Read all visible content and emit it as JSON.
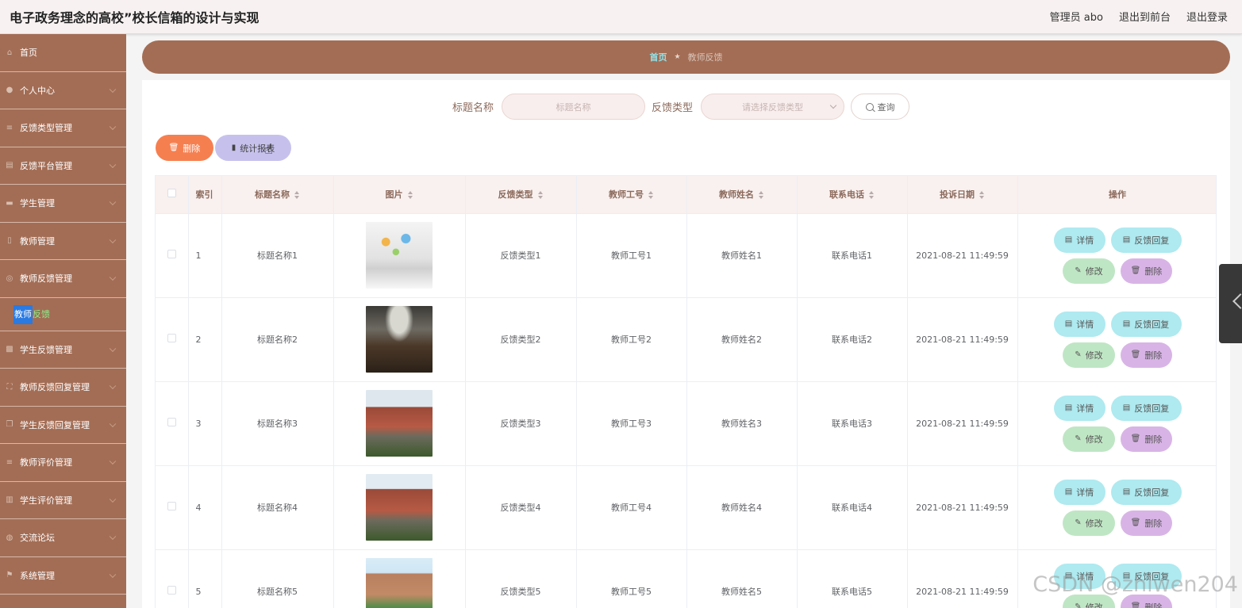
{
  "header": {
    "title": "电子政务理念的高校”校长信箱的设计与实现",
    "admin": "管理员 abo",
    "to_front": "退出到前台",
    "logout": "退出登录"
  },
  "sidebar": {
    "items": [
      {
        "label": "首页",
        "icon": "home-icon",
        "has_arrow": false
      },
      {
        "label": "个人中心",
        "icon": "user-icon",
        "has_arrow": true
      },
      {
        "label": "反馈类型管理",
        "icon": "list-icon",
        "has_arrow": true
      },
      {
        "label": "反馈平台管理",
        "icon": "document-icon",
        "has_arrow": true
      },
      {
        "label": "学生管理",
        "icon": "chat-icon",
        "has_arrow": true
      },
      {
        "label": "教师管理",
        "icon": "phone-icon",
        "has_arrow": true
      },
      {
        "label": "教师反馈管理",
        "icon": "compass-icon",
        "has_arrow": true
      }
    ],
    "active_sub": {
      "highlight": "教师",
      "rest": "反馈"
    },
    "items_after": [
      {
        "label": "学生反馈管理",
        "icon": "grid-icon",
        "has_arrow": true
      },
      {
        "label": "教师反馈回复管理",
        "icon": "frame-icon",
        "has_arrow": true
      },
      {
        "label": "学生反馈回复管理",
        "icon": "copy-icon",
        "has_arrow": true
      },
      {
        "label": "教师评价管理",
        "icon": "list-icon",
        "has_arrow": true
      },
      {
        "label": "学生评价管理",
        "icon": "bar-icon",
        "has_arrow": true
      },
      {
        "label": "交流论坛",
        "icon": "globe-icon",
        "has_arrow": true
      },
      {
        "label": "系统管理",
        "icon": "flag-icon",
        "has_arrow": true
      }
    ]
  },
  "breadcrumb": {
    "home": "首页",
    "current": "教师反馈"
  },
  "search": {
    "title_label": "标题名称",
    "title_placeholder": "标题名称",
    "type_label": "反馈类型",
    "type_placeholder": "请选择反馈类型",
    "query_label": "查询"
  },
  "toolbar": {
    "delete_label": "删除",
    "stats_label": "统计报表"
  },
  "table": {
    "headers": [
      "索引",
      "标题名称",
      "图片",
      "反馈类型",
      "教师工号",
      "教师姓名",
      "联系电话",
      "投诉日期",
      "操作"
    ],
    "rows": [
      {
        "index": "1",
        "title": "标题名称1",
        "image": "books-image",
        "type": "反馈类型1",
        "teacher_no": "教师工号1",
        "teacher_name": "教师姓名1",
        "phone": "联系电话1",
        "date": "2021-08-21 11:49:59"
      },
      {
        "index": "2",
        "title": "标题名称2",
        "image": "meeting-room-image",
        "type": "反馈类型2",
        "teacher_no": "教师工号2",
        "teacher_name": "教师姓名2",
        "phone": "联系电话2",
        "date": "2021-08-21 11:49:59"
      },
      {
        "index": "3",
        "title": "标题名称3",
        "image": "campus-building-image",
        "type": "反馈类型3",
        "teacher_no": "教师工号3",
        "teacher_name": "教师姓名3",
        "phone": "联系电话3",
        "date": "2021-08-21 11:49:59"
      },
      {
        "index": "4",
        "title": "标题名称4",
        "image": "campus-building-image",
        "type": "反馈类型4",
        "teacher_no": "教师工号4",
        "teacher_name": "教师姓名4",
        "phone": "联系电话4",
        "date": "2021-08-21 11:49:59"
      },
      {
        "index": "5",
        "title": "标题名称5",
        "image": "campus-garden-image",
        "type": "反馈类型5",
        "teacher_no": "教师工号5",
        "teacher_name": "教师姓名5",
        "phone": "联系电话5",
        "date": "2021-08-21 11:49:59"
      }
    ],
    "actions": {
      "detail": "详情",
      "reply": "反馈回复",
      "edit": "修改",
      "delete": "删除"
    }
  },
  "watermark": "CSDN @zhiwen204",
  "colors": {
    "sidebar": "#a36d55",
    "breadcrumb_home": "#8fe3ea",
    "delete_btn": "#f67f50",
    "stats_btn": "#c6c1ec",
    "detail_btn": "#aeeaf0",
    "edit_btn": "#bfe6c4",
    "delete_row_btn": "#d8b4e6"
  }
}
